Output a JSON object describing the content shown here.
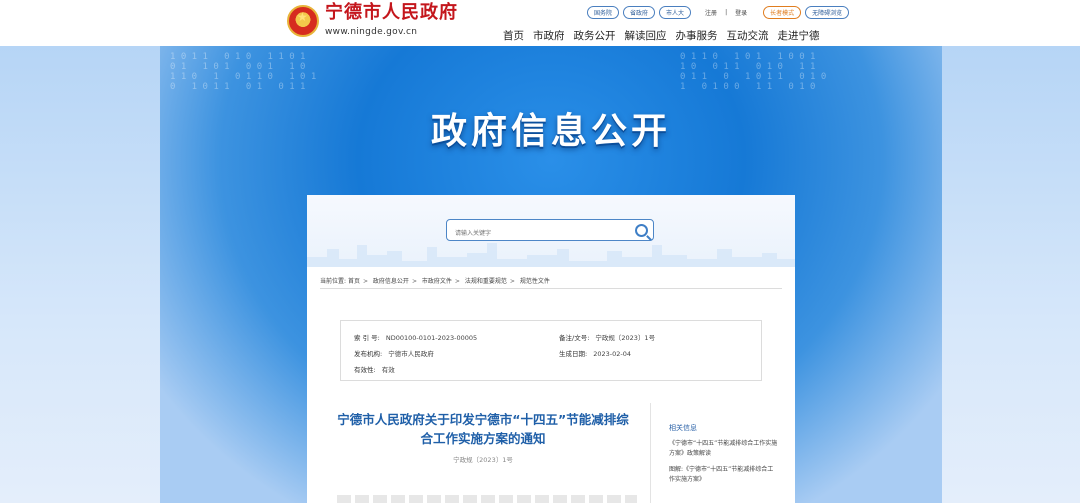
{
  "header": {
    "logo_title": "宁德市人民政府",
    "logo_url": "www.ningde.gov.cn",
    "links": [
      "国务院",
      "省政府",
      "市人大",
      "注册",
      "登录",
      "长者模式",
      "无障碍浏览"
    ],
    "nav": [
      "首页",
      "市政府",
      "政务公开",
      "解读回应",
      "办事服务",
      "互动交流",
      "走进宁德"
    ]
  },
  "banner": {
    "title": "政府信息公开"
  },
  "search": {
    "placeholder": "请输入关键字"
  },
  "breadcrumb": {
    "prefix": "当前位置:",
    "items": [
      "首页",
      "政府信息公开",
      "市政府文件",
      "法规和重要规范",
      "规范性文件"
    ]
  },
  "meta": {
    "index_label": "索 引 号:",
    "index_value": "ND00100-0101-2023-00005",
    "record_label": "备注/文号:",
    "record_value": "宁政规〔2023〕1号",
    "issuer_label": "发布机构:",
    "issuer_value": "宁德市人民政府",
    "date_label": "生成日期:",
    "date_value": "2023-02-04",
    "validity_label": "有效性:",
    "validity_value": "有效"
  },
  "article": {
    "title_line1": "宁德市人民政府关于印发宁德市“十四五”节能减排综",
    "title_line2": "合工作实施方案的通知",
    "doc_no": "宁政规〔2023〕1号"
  },
  "related": {
    "title": "相关信息",
    "items": [
      "《宁德市“十四五”节能减排综合工作实施方案》政策解读",
      "图解:《宁德市“十四五”节能减排综合工作实施方案》"
    ]
  }
}
